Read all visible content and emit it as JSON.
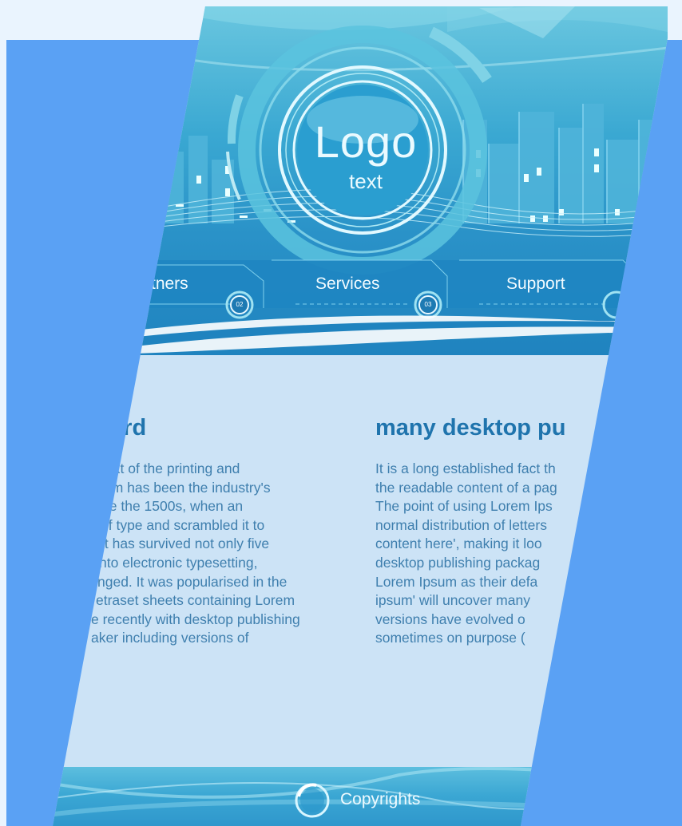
{
  "logo": {
    "title": "Logo",
    "subtitle": "text"
  },
  "nav": {
    "items": [
      {
        "label": "rtners",
        "badge": "02"
      },
      {
        "label": "Services",
        "badge": "03"
      },
      {
        "label": "Support",
        "badge": ""
      }
    ]
  },
  "content": {
    "left": {
      "title": "lard",
      "lines": [
        "ext of the printing and",
        "um has been the industry's",
        "ce the 1500s, when an",
        "of type and scrambled it to",
        "It has survived not only five",
        "nto electronic typesetting,",
        "nged. It was popularised in the",
        "etraset sheets containing Lorem",
        "e recently with desktop publishing",
        "aker including versions of"
      ]
    },
    "right": {
      "title": "many desktop pu",
      "lines": [
        "It is a long established fact th",
        "the readable content of a pag",
        "The point of using Lorem Ips",
        "normal distribution of letters",
        "content here', making it loo",
        "desktop publishing packag",
        "Lorem Ipsum as their defa",
        "ipsum' will uncover many",
        "versions have evolved o",
        "sometimes on purpose ("
      ]
    }
  },
  "footer": {
    "copyrights": "Copyrights"
  },
  "colors": {
    "page_bg": "#5aa1f4",
    "header_blue": "#2a92c8",
    "title_blue": "#1f74ad",
    "body_text": "#3f7fae",
    "content_bg": "#cce3f6"
  }
}
